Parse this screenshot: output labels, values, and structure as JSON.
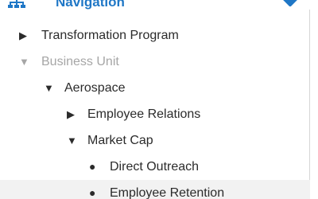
{
  "header": {
    "title": "Navigation",
    "icon": "sitemap-icon",
    "accent_color": "#1f77c6"
  },
  "tree": [
    {
      "label": "Transformation Program",
      "state": "collapsed",
      "glyph": "▶"
    },
    {
      "label": "Business Unit",
      "state": "expanded",
      "glyph": "▼",
      "muted": true
    },
    {
      "label": "Aerospace",
      "state": "expanded",
      "glyph": "▼"
    },
    {
      "label": "Employee Relations",
      "state": "collapsed",
      "glyph": "▶"
    },
    {
      "label": "Market Cap",
      "state": "expanded",
      "glyph": "▼"
    },
    {
      "label": "Direct Outreach",
      "state": "leaf",
      "glyph": "●"
    },
    {
      "label": "Employee Retention",
      "state": "leaf",
      "glyph": "●",
      "highlighted": true
    }
  ]
}
